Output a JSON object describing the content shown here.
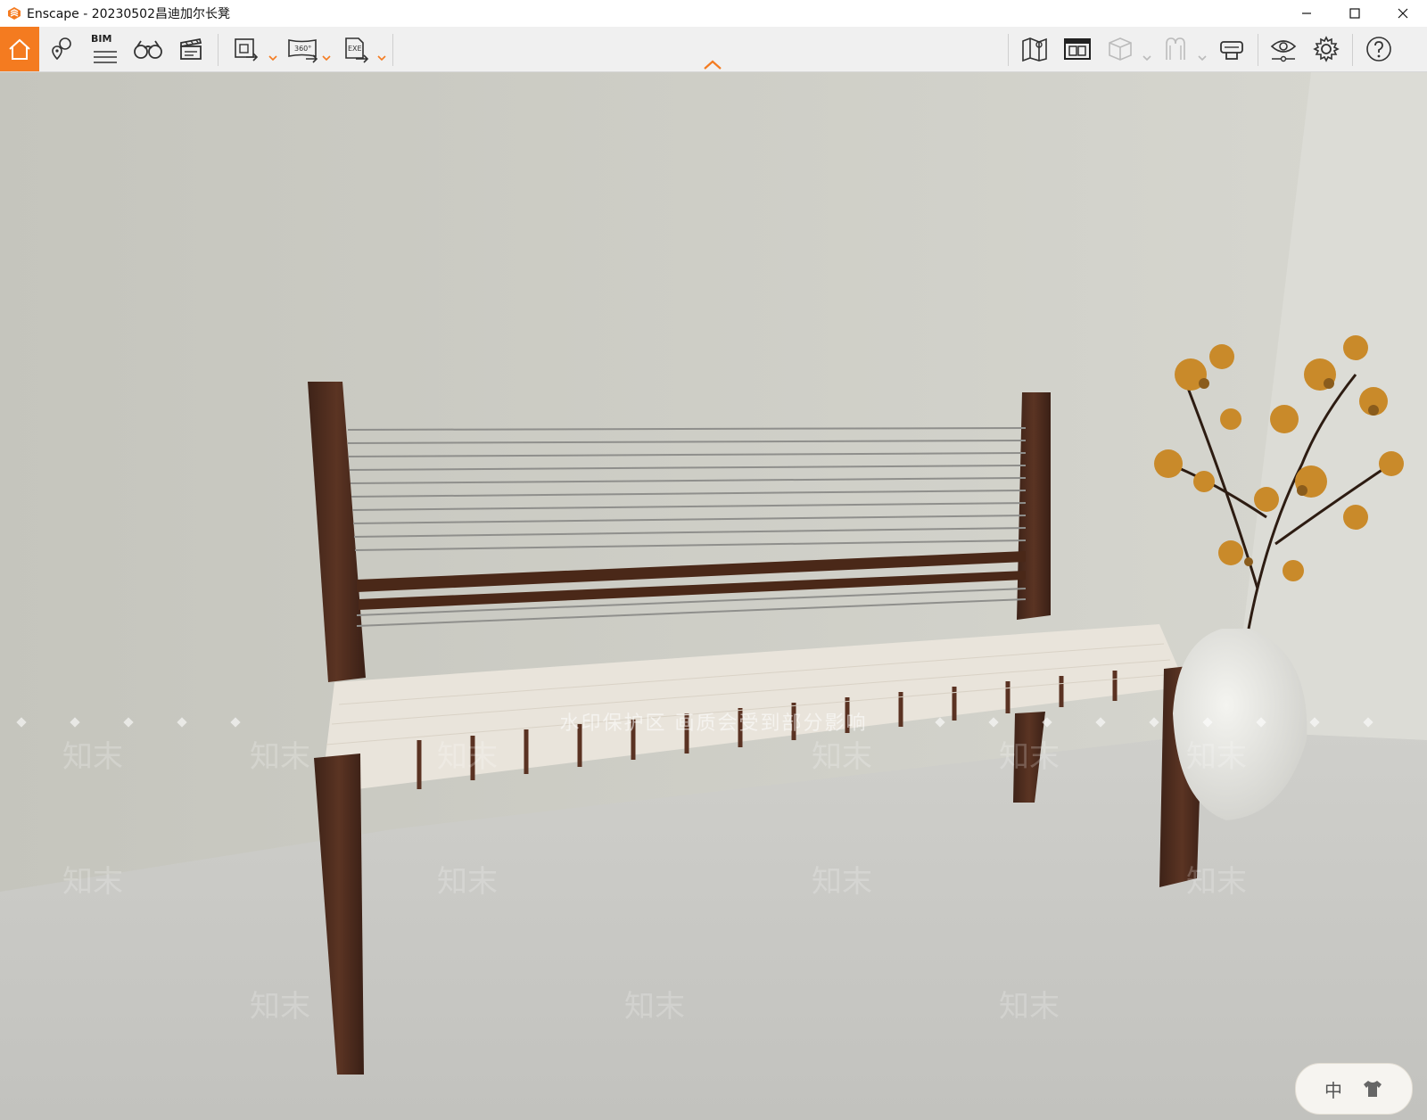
{
  "window": {
    "title": "Enscape - 20230502昌迪加尔长凳",
    "controls": [
      "minimize",
      "maximize",
      "close"
    ]
  },
  "toolbar": {
    "left_tools": [
      {
        "name": "home-icon"
      },
      {
        "name": "location-pins-icon"
      },
      {
        "name": "bim-icon",
        "label": "BIM"
      },
      {
        "name": "binoculars-icon"
      },
      {
        "name": "clapperboard-icon"
      },
      {
        "name": "export-image-icon",
        "dropdown": true
      },
      {
        "name": "export-panorama-icon",
        "label": "360°",
        "dropdown": true
      },
      {
        "name": "export-exe-icon",
        "label": "EXE",
        "dropdown": true
      }
    ],
    "right_tools": [
      {
        "name": "map-icon"
      },
      {
        "name": "asset-library-icon"
      },
      {
        "name": "cube-view-icon",
        "dropdown": true
      },
      {
        "name": "vr-icon",
        "dropdown": true
      },
      {
        "name": "headset-icon"
      },
      {
        "name": "visual-settings-icon"
      },
      {
        "name": "settings-gear-icon"
      },
      {
        "name": "help-icon"
      }
    ],
    "accent_color": "#f47b20"
  },
  "viewport": {
    "scene": "wooden bench with woven seat and vase with branches",
    "watermark_text": "水印保护区  画质会受到部分影响",
    "watermark_brand": "知末"
  },
  "ime": {
    "language": "中"
  }
}
